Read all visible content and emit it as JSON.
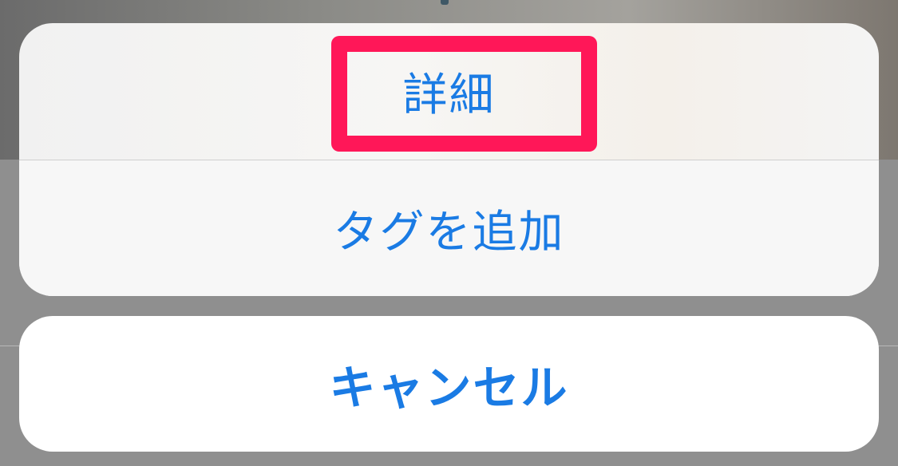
{
  "action_sheet": {
    "actions": [
      {
        "label": "詳細",
        "highlighted": true
      },
      {
        "label": "タグを追加",
        "highlighted": false
      }
    ],
    "cancel_label": "キャンセル"
  },
  "colors": {
    "action_text": "#1a7be4",
    "highlight": "#ff1758",
    "backdrop": "#8f8f8f",
    "sheet_background": "#f6f6f6",
    "cancel_background": "#ffffff"
  }
}
